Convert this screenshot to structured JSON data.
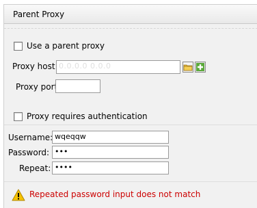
{
  "panel": {
    "title": "Parent Proxy"
  },
  "use_parent_proxy": {
    "label": "Use a parent proxy",
    "checked": false
  },
  "proxy_host": {
    "label": "Proxy host:",
    "value": "0.0.0.0   0.0.0",
    "browse_icon": "folder-icon",
    "add_icon": "plus-icon"
  },
  "proxy_port": {
    "label": "Proxy port:",
    "value": ""
  },
  "requires_auth": {
    "label": "Proxy requires authentication",
    "checked": false
  },
  "username": {
    "label": "Username:",
    "value": "wqeqqw"
  },
  "password": {
    "label": "Password:",
    "value": "•••"
  },
  "repeat": {
    "label": "Repeat:",
    "value": "••••"
  },
  "warning": {
    "icon": "warning-icon",
    "message": "Repeated password input does not match",
    "color": "#cc0000"
  },
  "colors": {
    "panel_bg": "#f1f1f1",
    "folder": "#e8b838",
    "plus_bg": "#5aa83a"
  }
}
